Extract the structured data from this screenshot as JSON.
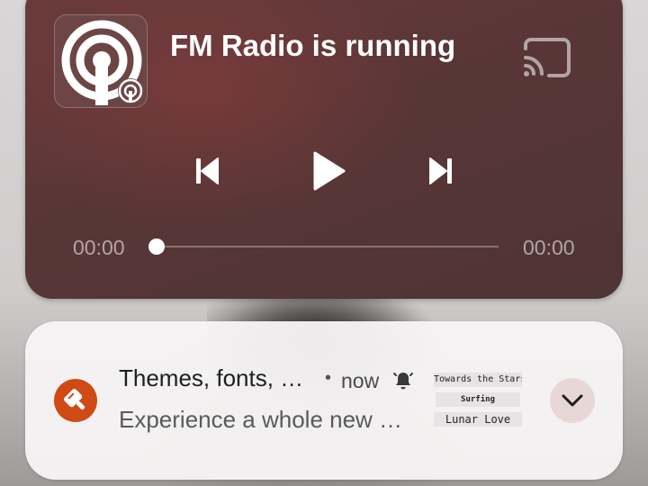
{
  "media": {
    "title": "FM Radio is running",
    "elapsed": "00:00",
    "duration": "00:00",
    "progress": 0,
    "controls": [
      "prev-icon",
      "play-icon",
      "next-icon"
    ],
    "cast_icon": "cast-icon",
    "album_icon": "podcast-icon",
    "colors": {
      "card": "#5a3737",
      "text": "#ffffff"
    }
  },
  "notification": {
    "app_icon": "brush-icon",
    "accent": "#cf4a14",
    "title": "Themes, fonts, …",
    "separator": "•",
    "time": "now",
    "bell_icon": "bell-icon",
    "body": "Experience a whole new …",
    "preview_lines": [
      "Towards the Stars",
      "Surfing",
      "Lunar  Love"
    ],
    "expand_icon": "chevron-down-icon"
  }
}
